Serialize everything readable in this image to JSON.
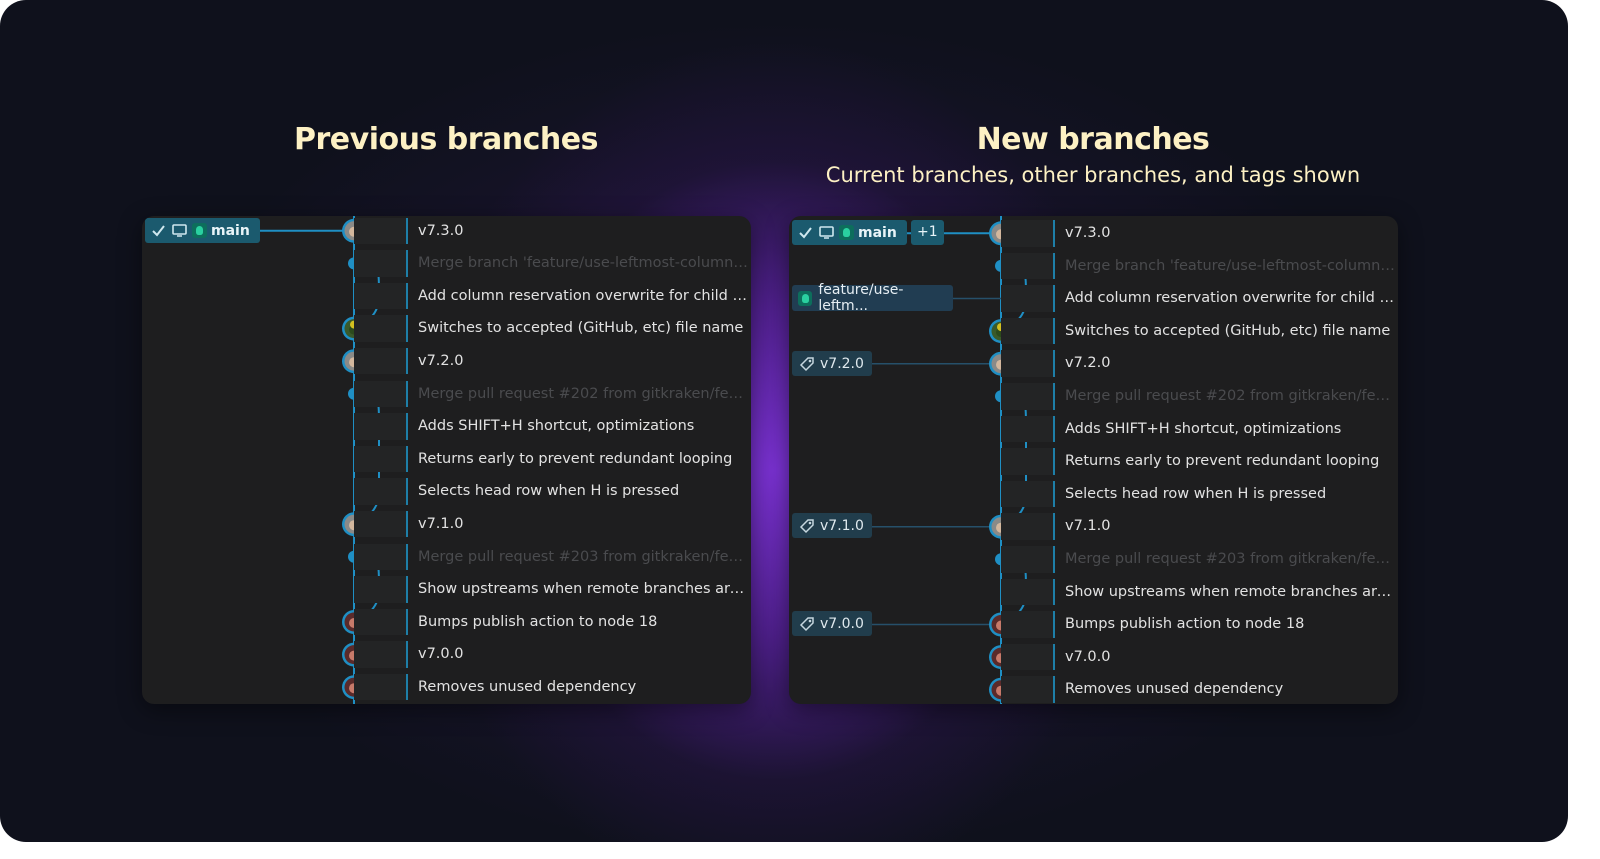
{
  "left": {
    "title": "Previous branches",
    "branch": {
      "label": "main"
    }
  },
  "right": {
    "title": "New branches",
    "subtitle": "Current branches, other branches, and tags shown",
    "branch": {
      "label": "main",
      "extra": "+1"
    },
    "feature_branch": "feature/use-leftm...",
    "tags": [
      "v7.2.0",
      "v7.1.0",
      "v7.0.0"
    ]
  },
  "commits": [
    {
      "message": "v7.3.0",
      "dim": false
    },
    {
      "message": "Merge branch 'feature/use-leftmost-column' in...",
      "dim": true
    },
    {
      "message": "Add column reservation overwrite for child with...",
      "dim": false
    },
    {
      "message": "Switches to accepted (GitHub, etc) file name",
      "dim": false
    },
    {
      "message": "v7.2.0",
      "dim": false
    },
    {
      "message": "Merge pull request #202 from gitkraken/featur...",
      "dim": true
    },
    {
      "message": "Adds SHIFT+H shortcut, optimizations",
      "dim": false
    },
    {
      "message": "Returns early to prevent redundant looping",
      "dim": false
    },
    {
      "message": "Selects head row when H is pressed",
      "dim": false
    },
    {
      "message": "v7.1.0",
      "dim": false
    },
    {
      "message": "Merge pull request #203 from gitkraken/featur...",
      "dim": true
    },
    {
      "message": "Show upstreams when remote branches are filt...",
      "dim": false
    },
    {
      "message": "Bumps publish action to node 18",
      "dim": false
    },
    {
      "message": "v7.0.0",
      "dim": false
    },
    {
      "message": "Removes unused dependency",
      "dim": false
    }
  ],
  "colors": {
    "graph_line": "#1f8fc4",
    "branch_pill": "#1b5a6e",
    "tag_pill": "#213d4c",
    "heading": "#fdf1c4"
  }
}
